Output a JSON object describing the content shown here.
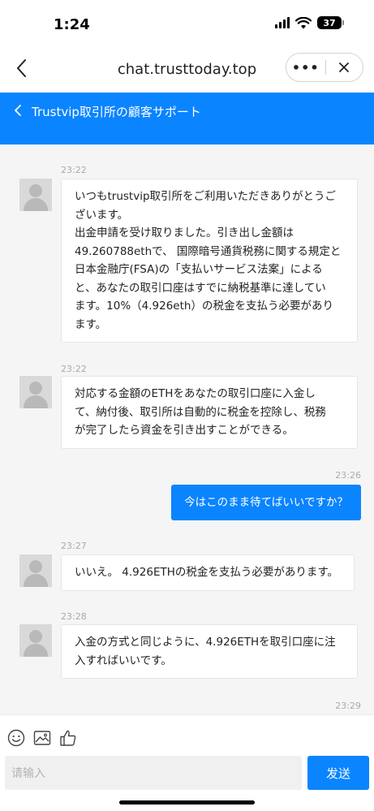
{
  "status_bar": {
    "time": "1:24",
    "battery": "37"
  },
  "browser": {
    "url": "chat.trusttoday.top",
    "more_label": "•••"
  },
  "chat_header": {
    "title": "Trustvip取引所の顧客サポート"
  },
  "messages": [
    {
      "time": "23:22",
      "from": "agent",
      "text": "いつもtrustvip取引所をご利用いただきありがとうご\nざいます。\n出金申請を受け取りました。引き出し金額は\n49.260788ethで、 国際暗号通貨税務に関する規定と\n日本金融庁(FSA)の「支払いサービス法案」による\nと、あなたの取引口座はすでに納税基準に達してい\nます。10%（4.926eth）の税金を支払う必要があり\nます。"
    },
    {
      "time": "23:22",
      "from": "agent",
      "text": "対応する金額のETHをあなたの取引口座に入金し\nて、納付後、取引所は自動的に税金を控除し、税務\nが完了したら資金を引き出すことができる。"
    },
    {
      "time": "23:26",
      "from": "user",
      "text": "今はこのまま待てばいいですか？"
    },
    {
      "time": "23:27",
      "from": "agent",
      "text": "いいえ。 4.926ETHの税金を支払う必要があります。"
    },
    {
      "time": "23:28",
      "from": "agent",
      "text": "入金の方式と同じように、4.926ETHを取引口座に注\n入すればいいです。"
    },
    {
      "time": "23:29"
    }
  ],
  "input": {
    "placeholder": "请输入",
    "send_label": "发送"
  },
  "colors": {
    "accent": "#0a84ff",
    "chat_background": "#f5f5f5"
  },
  "icons": [
    "back-chevron-icon",
    "more-icon",
    "close-icon",
    "emoji-icon",
    "image-icon",
    "thumbs-up-icon"
  ]
}
